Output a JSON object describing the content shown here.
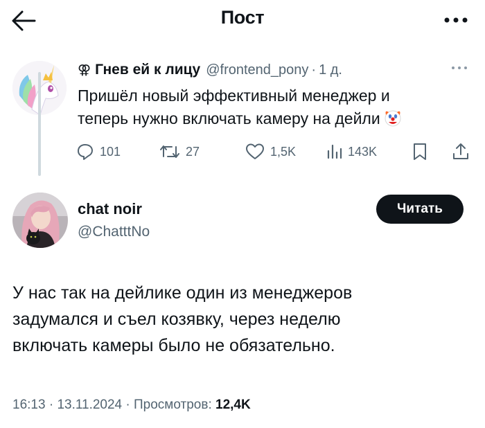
{
  "header": {
    "title": "Пост",
    "back_icon": "arrow-left-icon",
    "more_icon": "more-dots-icon"
  },
  "parent_post": {
    "author_name": "Гнев ей к лицу",
    "author_symbol": "⚢",
    "handle": "@frontend_pony",
    "separator": "·",
    "time": "1 д.",
    "text_line1": "Пришёл новый эффективный менеджер и",
    "text_line2": "теперь нужно включать камеру на дейли",
    "emoji": "clown-face-emoji",
    "actions": {
      "replies": "101",
      "reposts": "27",
      "likes": "1,5K",
      "views": "143K"
    }
  },
  "main_post": {
    "author_name": "chat noir",
    "handle": "@ChatttNo",
    "follow_label": "Читать",
    "text_line1": "У нас так на дейлике один из менеджеров",
    "text_line2": "задумался и съел козявку, через неделю",
    "text_line3": "включать камеры было не обязательно.",
    "time": "16:13",
    "date": "13.11.2024",
    "meta_separator": "·",
    "views_label": "Просмотров:",
    "views_count": "12,4K"
  },
  "colors": {
    "text_primary": "#0f1419",
    "text_secondary": "#536471",
    "button_bg": "#0f1419",
    "thread_line": "#cfd9de"
  }
}
